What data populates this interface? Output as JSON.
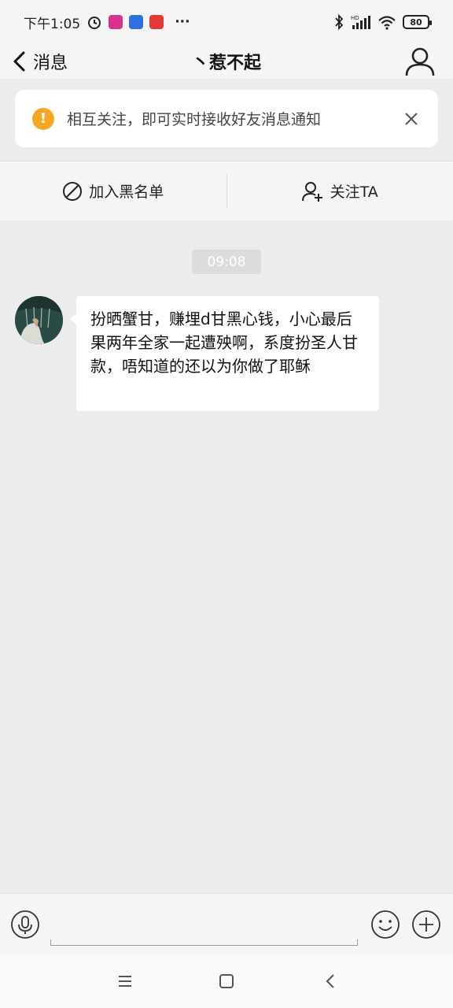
{
  "status_bar": {
    "time": "下午1:05",
    "battery": "80",
    "more": "···"
  },
  "header": {
    "back_label": "消息",
    "title": "丶惹不起"
  },
  "notice": {
    "text": "相互关注，即可实时接收好友消息通知",
    "icon": "!"
  },
  "actions": {
    "blacklist_label": "加入黑名单",
    "follow_label": "关注TA"
  },
  "chat": {
    "timestamp": "09:08",
    "messages": [
      {
        "sender": "other",
        "text": "扮晒蟹甘，赚埋d甘黑心钱，小心最后果两年全家一起遭殃啊，系度扮圣人甘款，唔知道的还以为你做了耶稣"
      }
    ]
  },
  "input": {
    "placeholder": ""
  },
  "colors": {
    "accent_warning": "#f5a623",
    "background": "#ececec",
    "bubble": "#ffffff"
  }
}
